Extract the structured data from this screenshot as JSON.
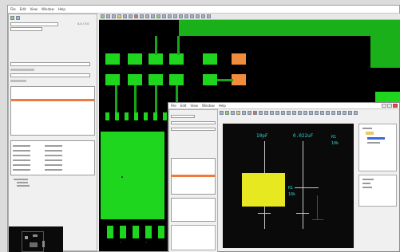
{
  "main_window": {
    "menu": [
      "File",
      "Edit",
      "View",
      "Window",
      "Help"
    ]
  },
  "left_panel": {
    "header_value": "4.0 / 3.0",
    "list_rows": [
      "",
      "",
      "",
      "",
      "",
      "",
      "",
      ""
    ],
    "properties": [
      {
        "key": "",
        "val": ""
      },
      {
        "key": "",
        "val": ""
      },
      {
        "key": "",
        "val": ""
      },
      {
        "key": "",
        "val": ""
      },
      {
        "key": "",
        "val": ""
      },
      {
        "key": "",
        "val": ""
      }
    ]
  },
  "popup_window": {
    "menu": [
      "File",
      "Edit",
      "View",
      "Window",
      "Help"
    ]
  },
  "schematic": {
    "labels": [
      "10pF",
      "0.022uF",
      "R1",
      "10k",
      "R1",
      "10k"
    ],
    "note_lines": [
      "",
      "",
      "",
      ""
    ]
  },
  "colors": {
    "pcb_background": "#000000",
    "copper": "#1fd61f",
    "selected_pad": "#f08c3c",
    "schematic_note": "#e8e820",
    "schematic_text": "#2bd4d4"
  }
}
